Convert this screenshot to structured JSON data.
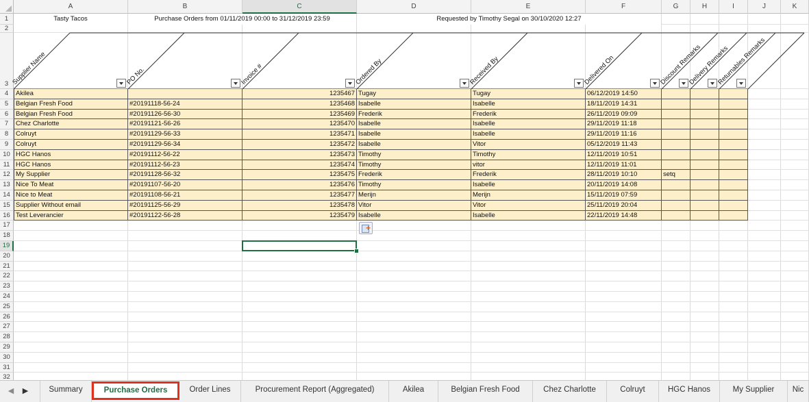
{
  "columns": [
    "A",
    "B",
    "C",
    "D",
    "E",
    "F",
    "G",
    "H",
    "I",
    "J",
    "K"
  ],
  "selected_column": "C",
  "selected_row": 19,
  "title_row": {
    "restaurant": "Tasty Tacos",
    "period": "Purchase Orders from 01/11/2019 00:00 to 31/12/2019 23:59",
    "requested": "Requested by Timothy Segal on 30/10/2020 12:27"
  },
  "headers": [
    "Supplier Name",
    "PO No.",
    "Invoice #",
    "Ordered By",
    "Received By",
    "Delivered On",
    "Discount Remarks",
    "Delivery Remarks",
    "Returnables Remarks"
  ],
  "rows": [
    [
      "Akilea",
      "",
      "1235467",
      "Tugay",
      "Tugay",
      "06/12/2019 14:50",
      "",
      "",
      ""
    ],
    [
      "Belgian Fresh Food",
      "#20191118-56-24",
      "1235468",
      "Isabelle",
      "Isabelle",
      "18/11/2019 14:31",
      "",
      "",
      ""
    ],
    [
      "Belgian Fresh Food",
      "#20191126-56-30",
      "1235469",
      "Frederik",
      "Frederik",
      "26/11/2019 09:09",
      "",
      "",
      ""
    ],
    [
      "Chez Charlotte",
      "#20191121-56-26",
      "1235470",
      "Isabelle",
      "Isabelle",
      "29/11/2019 11:18",
      "",
      "",
      ""
    ],
    [
      "Colruyt",
      "#20191129-56-33",
      "1235471",
      "Isabelle",
      "Isabelle",
      "29/11/2019 11:16",
      "",
      "",
      ""
    ],
    [
      "Colruyt",
      "#20191129-56-34",
      "1235472",
      "Isabelle",
      "Vitor",
      "05/12/2019 11:43",
      "",
      "",
      ""
    ],
    [
      "HGC Hanos",
      "#20191112-56-22",
      "1235473",
      "Timothy",
      "Timothy",
      "12/11/2019 10:51",
      "",
      "",
      ""
    ],
    [
      "HGC Hanos",
      "#20191112-56-23",
      "1235474",
      "Timothy",
      "vitor",
      "12/11/2019 11:01",
      "",
      "",
      ""
    ],
    [
      "My Supplier",
      "#20191128-56-32",
      "1235475",
      "Frederik",
      "Frederik",
      "28/11/2019 10:10",
      "setq",
      "",
      ""
    ],
    [
      "Nice To Meat",
      "#20191107-56-20",
      "1235476",
      "Timothy",
      "Isabelle",
      "20/11/2019 14:08",
      "",
      "",
      ""
    ],
    [
      "Nice to Meat",
      "#20191108-56-21",
      "1235477",
      "Merijn",
      "Merijn",
      "15/11/2019 07:59",
      "",
      "",
      ""
    ],
    [
      "Supplier Without email",
      "#20191125-56-29",
      "1235478",
      "Vitor",
      "Vitor",
      "25/11/2019 20:04",
      "",
      "",
      ""
    ],
    [
      "Test Leverancier",
      "#20191122-56-28",
      "1235479",
      "Isabelle",
      "Isabelle",
      "22/11/2019 14:48",
      "",
      "",
      ""
    ]
  ],
  "sheet_tabs": [
    "Summary",
    "Purchase Orders",
    "Order Lines",
    "Procurement Report (Aggregated)",
    "Akilea",
    "Belgian Fresh Food",
    "Chez Charlotte",
    "Colruyt",
    "HGC Hanos",
    "My Supplier",
    "Nic"
  ],
  "active_tab": "Purchase Orders",
  "nav": {
    "prev": "◀",
    "next": "▶"
  },
  "colors": {
    "data_fill": "#fcefc9",
    "accent": "#1f6e43",
    "highlight": "#e0301e"
  }
}
